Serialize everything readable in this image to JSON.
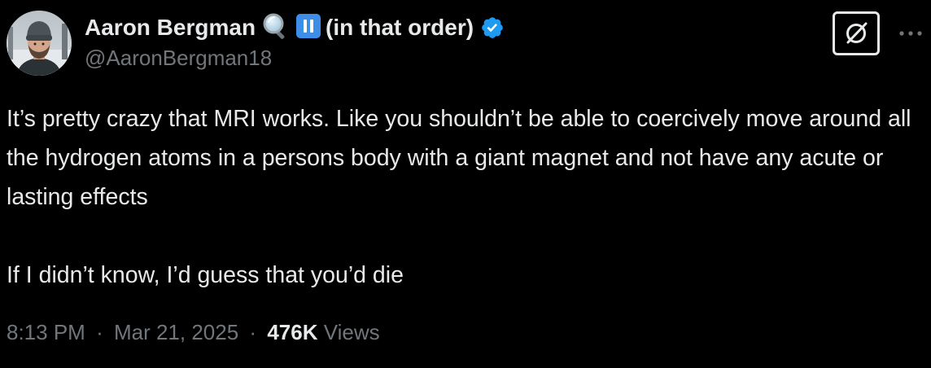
{
  "author": {
    "display_name": "Aaron Bergman",
    "name_suffix": "(in that order)",
    "handle": "@AaronBergman18",
    "emojis": [
      "magnifying-glass-icon",
      "pause-icon"
    ],
    "verified": true,
    "verified_color": "#1d9bf0"
  },
  "tweet": {
    "paragraph_1": "It’s pretty crazy that MRI works. Like you shouldn’t be able to coercively move around all the hydrogen atoms in a persons body with a giant magnet and not have any acute or lasting effects",
    "paragraph_2": "If I didn’t know, I’d guess that you’d die"
  },
  "meta": {
    "time": "8:13 PM",
    "separator": "·",
    "date": "Mar 21, 2025",
    "views_count": "476K",
    "views_label": "Views"
  },
  "actions": {
    "grok_icon": "grok-icon",
    "more_icon": "more-dots-icon"
  },
  "colors": {
    "background": "#000000",
    "text_primary": "#e7e9ea",
    "text_secondary": "#71767b",
    "accent": "#1d9bf0"
  }
}
